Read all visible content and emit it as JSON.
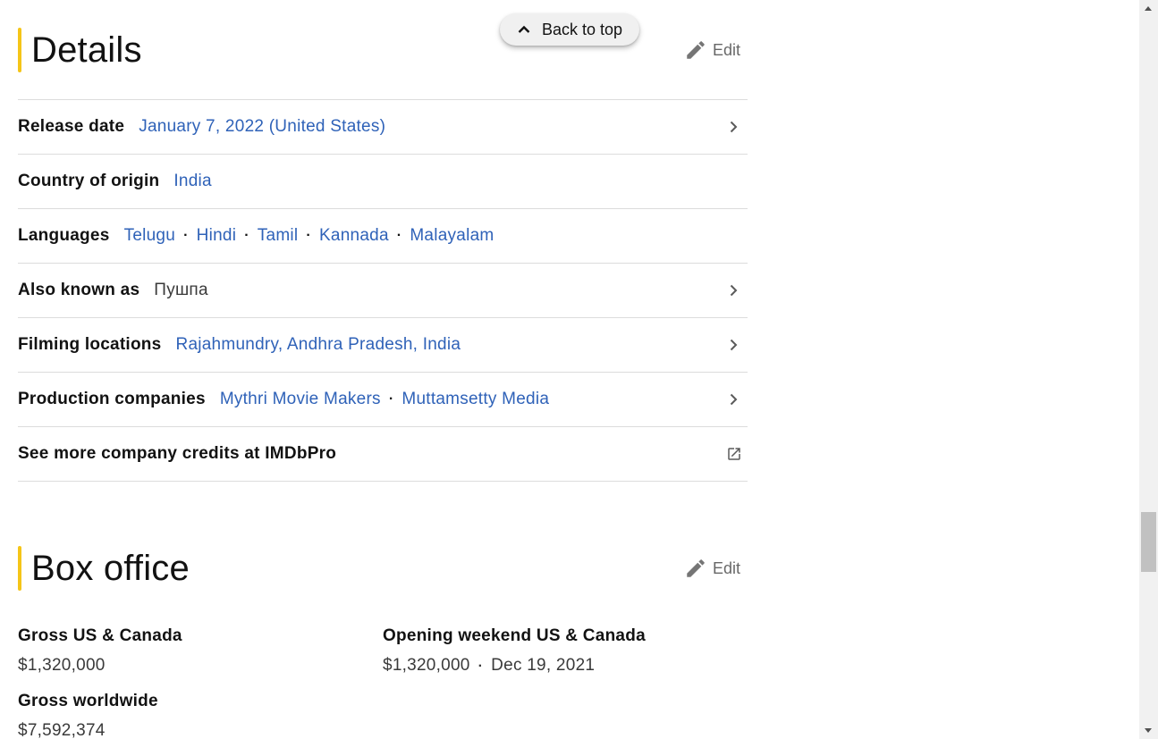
{
  "back_to_top": {
    "label": "Back to top",
    "icon": "chevron-up-icon"
  },
  "details": {
    "title": "Details",
    "edit_label": "Edit",
    "rows": {
      "release_date": {
        "label": "Release date",
        "value": "January 7, 2022 (United States)"
      },
      "country": {
        "label": "Country of origin",
        "value": "India"
      },
      "languages": {
        "label": "Languages",
        "values": [
          "Telugu",
          "Hindi",
          "Tamil",
          "Kannada",
          "Malayalam"
        ]
      },
      "aka": {
        "label": "Also known as",
        "value": "Пушпа"
      },
      "filming": {
        "label": "Filming locations",
        "value": "Rajahmundry, Andhra Pradesh, India"
      },
      "production": {
        "label": "Production companies",
        "values": [
          "Mythri Movie Makers",
          "Muttamsetty Media"
        ]
      },
      "imdbpro": {
        "label": "See more company credits at IMDbPro"
      }
    },
    "separator": "·"
  },
  "box_office": {
    "title": "Box office",
    "edit_label": "Edit",
    "gross_us": {
      "label": "Gross US & Canada",
      "value": "$1,320,000"
    },
    "opening": {
      "label": "Opening weekend US & Canada",
      "value": "$1,320,000",
      "date": "Dec 19, 2021"
    },
    "gross_world": {
      "label": "Gross worldwide",
      "value": "$7,592,374"
    }
  },
  "colors": {
    "accent": "#f5c518",
    "link": "#2f62b8",
    "text": "#121212"
  }
}
